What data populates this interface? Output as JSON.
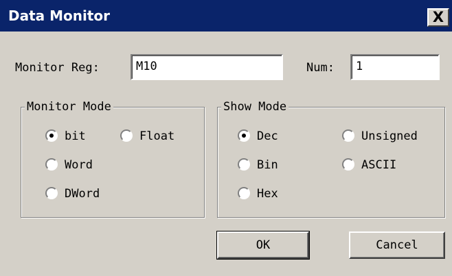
{
  "window": {
    "title": "Data Monitor",
    "close_glyph": "X"
  },
  "form": {
    "monitor_reg_label": "Monitor Reg:",
    "monitor_reg_value": "M10",
    "num_label": "Num:",
    "num_value": "1"
  },
  "monitor_mode": {
    "title": "Monitor Mode",
    "options": [
      {
        "label": "bit",
        "checked": true
      },
      {
        "label": "Float",
        "checked": false
      },
      {
        "label": "Word",
        "checked": false
      },
      {
        "label": "DWord",
        "checked": false
      }
    ]
  },
  "show_mode": {
    "title": "Show Mode",
    "options": [
      {
        "label": "Dec",
        "checked": true
      },
      {
        "label": "Unsigned",
        "checked": false
      },
      {
        "label": "Bin",
        "checked": false
      },
      {
        "label": "ASCII",
        "checked": false
      },
      {
        "label": "Hex",
        "checked": false
      }
    ]
  },
  "buttons": {
    "ok": "OK",
    "cancel": "Cancel"
  }
}
